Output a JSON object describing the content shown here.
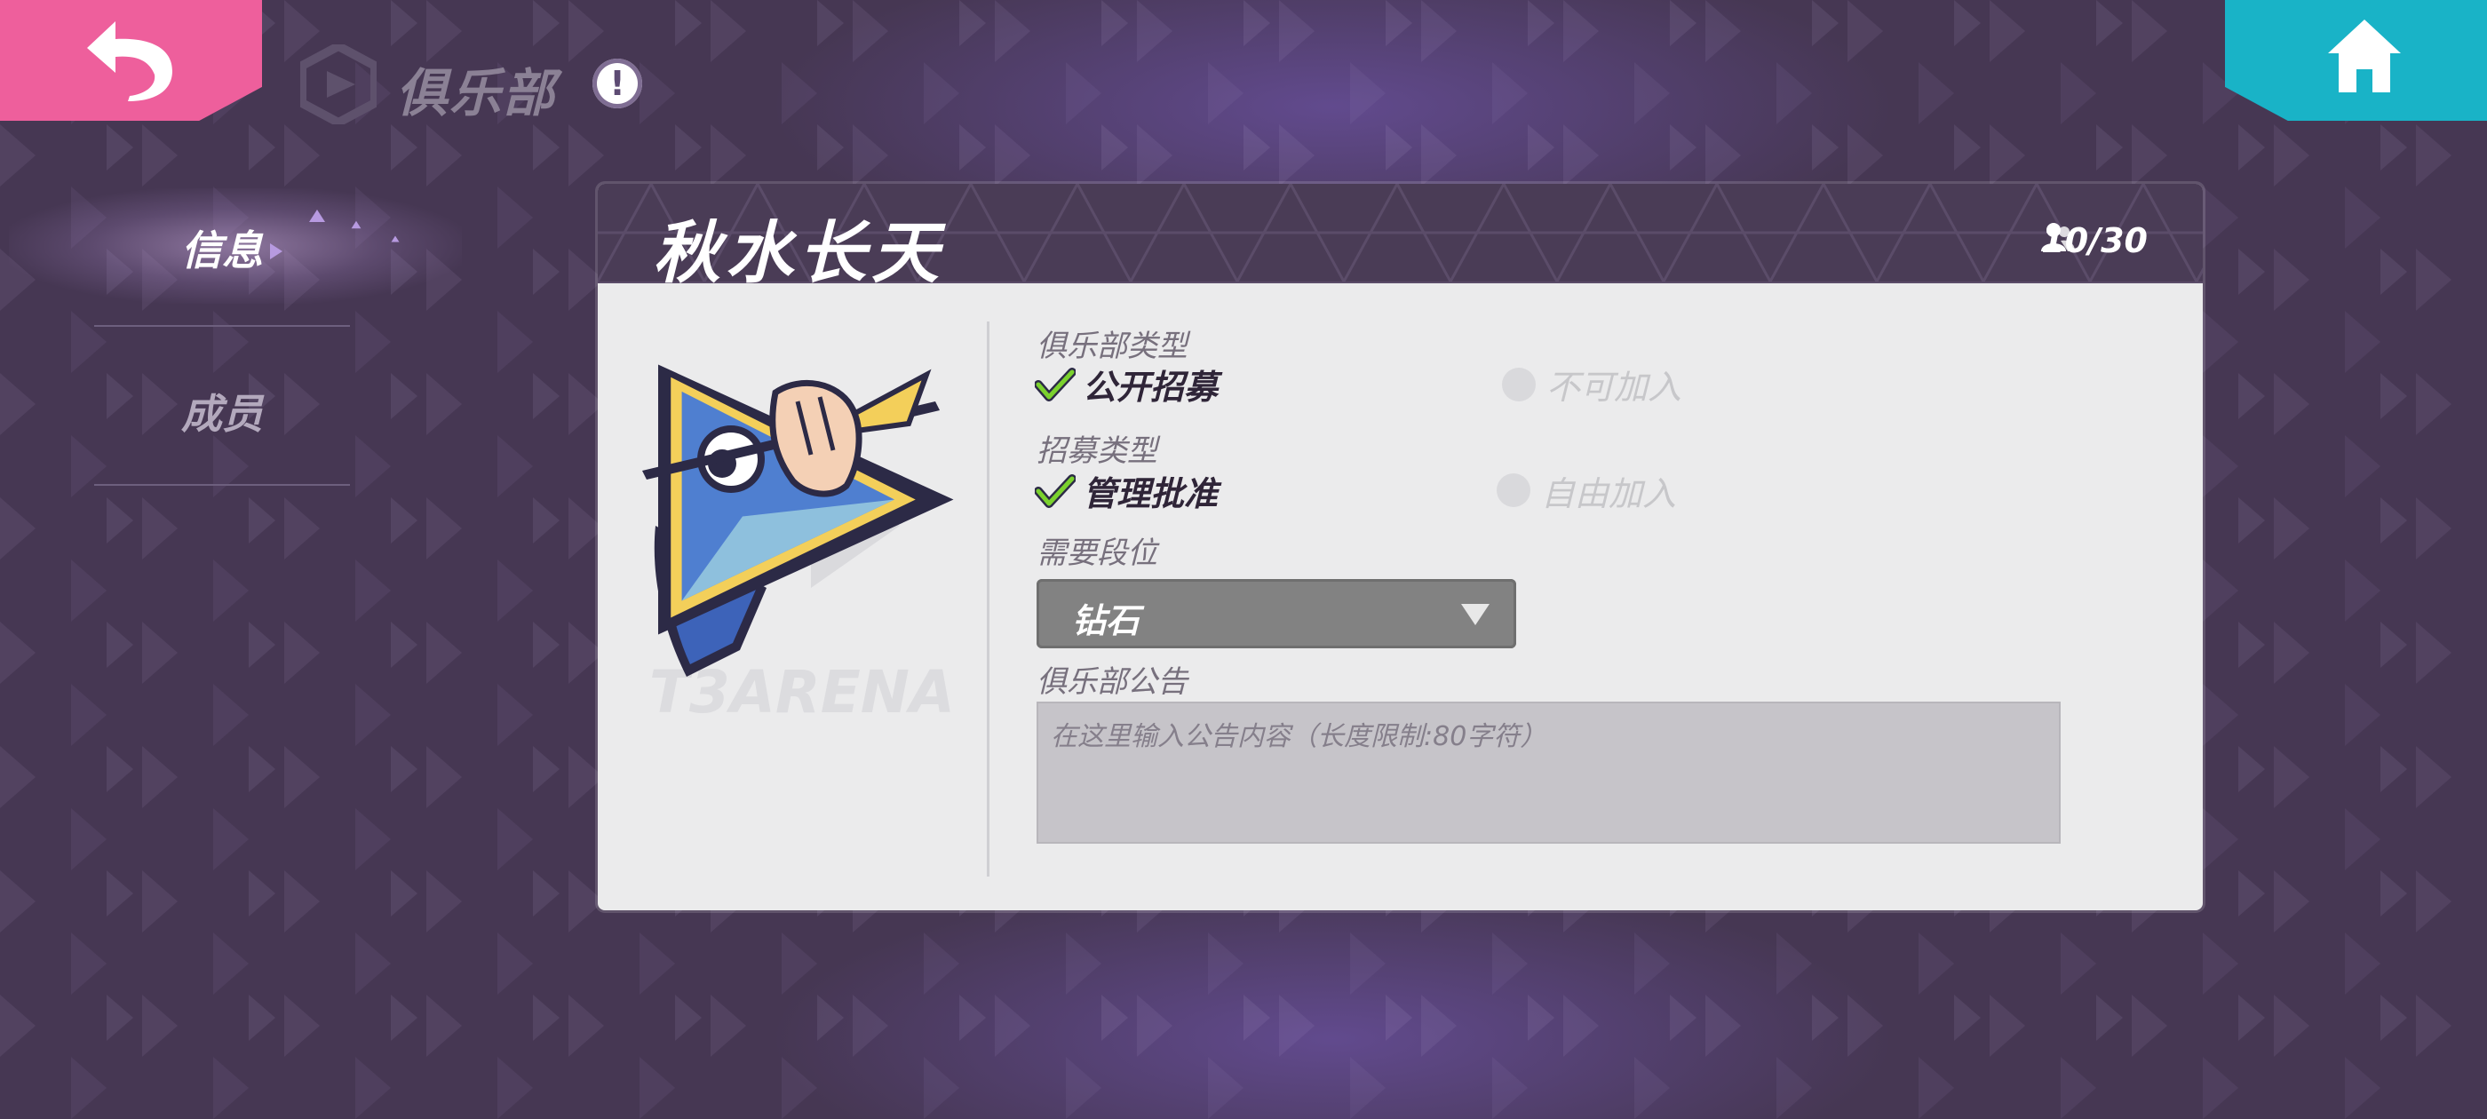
{
  "header": {
    "title": "俱乐部",
    "info_badge": "!",
    "back_icon": "back-arrow-icon",
    "home_icon": "home-icon",
    "colors": {
      "back": "#ee5f9c",
      "home": "#19b3c7",
      "background": "#463753"
    }
  },
  "sidebar": {
    "items": [
      {
        "label": "信息",
        "active": true
      },
      {
        "label": "成员",
        "active": false
      }
    ]
  },
  "club": {
    "name": "秋水长天",
    "member_count": "10/30",
    "emblem_watermark": "T3ARENA",
    "club_type": {
      "label": "俱乐部类型",
      "options": [
        {
          "label": "公开招募",
          "selected": true
        },
        {
          "label": "不可加入",
          "selected": false
        }
      ]
    },
    "recruit_type": {
      "label": "招募类型",
      "options": [
        {
          "label": "管理批准",
          "selected": true
        },
        {
          "label": "自由加入",
          "selected": false
        }
      ]
    },
    "required_rank": {
      "label": "需要段位",
      "value": "钻石"
    },
    "notice": {
      "label": "俱乐部公告",
      "placeholder": "在这里输入公告内容（长度限制:80字符）",
      "value": ""
    }
  }
}
